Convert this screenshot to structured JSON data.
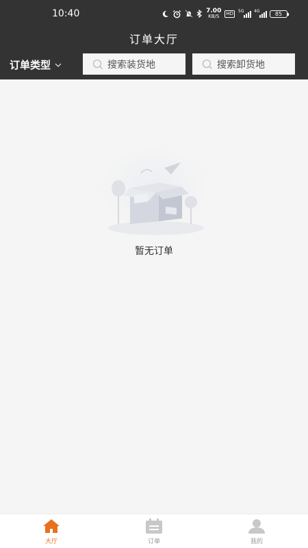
{
  "status_bar": {
    "time": "10:40",
    "net_speed_value": "7.00",
    "net_speed_unit": "KB/S",
    "hd_label": "HD",
    "signal1_label": "5G",
    "signal2_label": "4G",
    "battery": "85",
    "icons": [
      "moon-icon",
      "alarm-icon",
      "bell-off-icon",
      "bluetooth-icon"
    ]
  },
  "header": {
    "title": "订单大厅",
    "order_type_label": "订单类型",
    "search_load_placeholder": "搜索装货地",
    "search_unload_placeholder": "搜索卸货地"
  },
  "empty_state": {
    "message": "暂无订单"
  },
  "tab_bar": {
    "tabs": [
      {
        "label": "大厅",
        "icon": "home-icon",
        "active": true
      },
      {
        "label": "订单",
        "icon": "clipboard-icon",
        "active": false
      },
      {
        "label": "我的",
        "icon": "user-icon",
        "active": false
      }
    ]
  },
  "colors": {
    "header_bg": "#333333",
    "page_bg": "#f5f5f5",
    "accent": "#e8711f",
    "inactive_icon": "#c8c8c8"
  }
}
